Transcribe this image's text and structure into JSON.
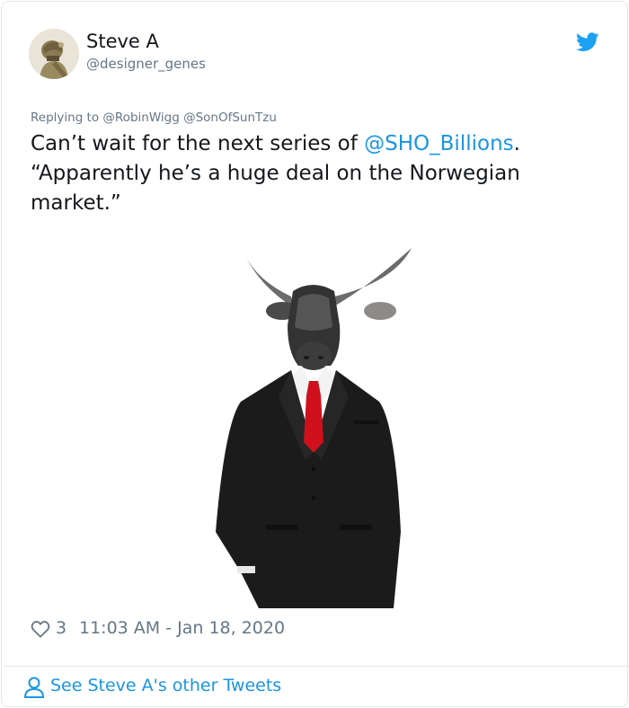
{
  "tweet": {
    "author_name": "Steve A",
    "author_handle": "@designer_genes",
    "replying_prefix": "Replying to",
    "replying_mentions": [
      "@RobinWigg",
      "@SonOfSunTzu"
    ],
    "text_before": "Can’t wait for the next series of ",
    "text_link": "@SHO_Billions",
    "text_after": ".\n“Apparently he’s a huge deal on the Norwegian market.”",
    "like_count": "3",
    "timestamp": "11:03 AM - Jan 18, 2020",
    "more_tweets_label": "See Steve A's other Tweets"
  },
  "icons": {
    "brand": "twitter-bird-icon",
    "like": "heart-icon",
    "profile": "person-icon"
  },
  "colors": {
    "link": "#1b95e0",
    "muted": "#657786",
    "border": "#e1e8ed",
    "text": "#14171a"
  }
}
